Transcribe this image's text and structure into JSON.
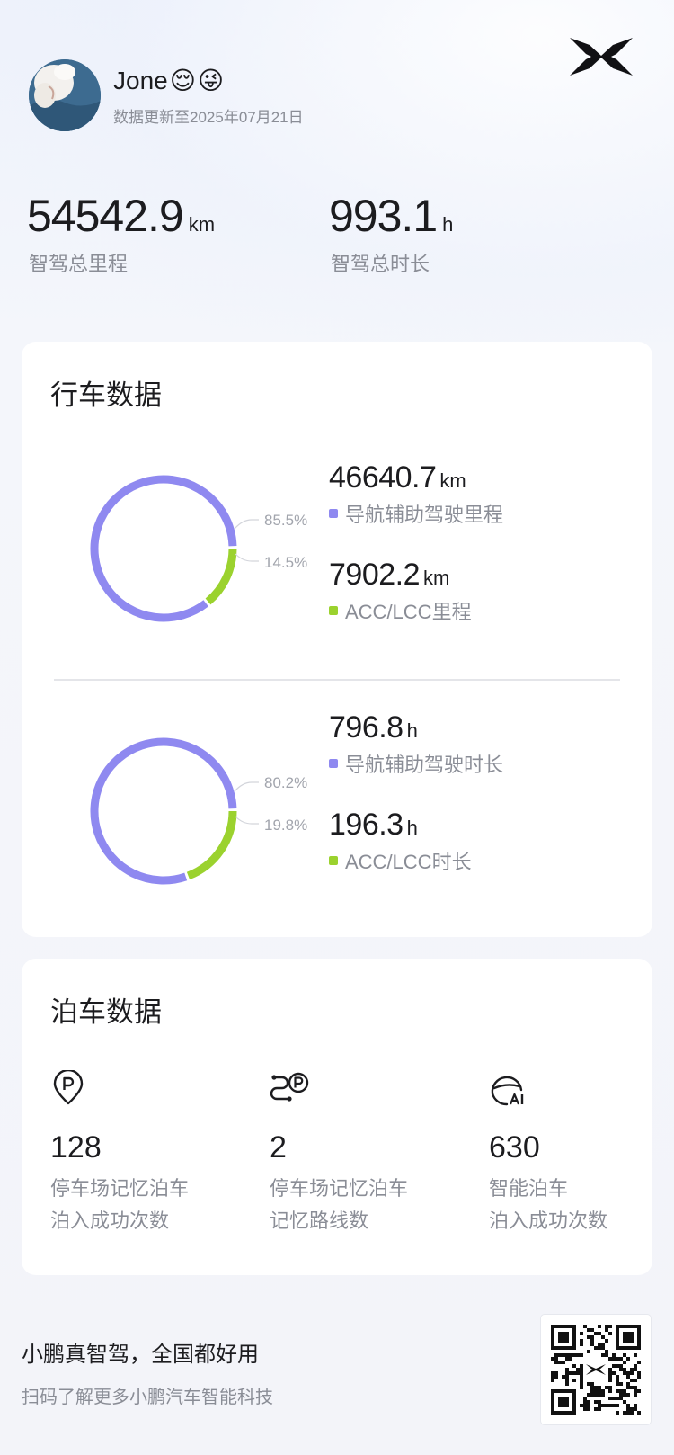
{
  "header": {
    "user_name": "Jone",
    "emojis": [
      "😌",
      "😜"
    ],
    "update_text": "数据更新至2025年07月21日"
  },
  "totals": {
    "mileage": {
      "value": "54542.9",
      "unit": "km",
      "label": "智驾总里程"
    },
    "duration": {
      "value": "993.1",
      "unit": "h",
      "label": "智驾总时长"
    }
  },
  "driving": {
    "title": "行车数据",
    "mileage": {
      "percent_primary": 85.5,
      "percent_secondary": 14.5,
      "percent_primary_label": "85.5%",
      "percent_secondary_label": "14.5%",
      "nav": {
        "value": "46640.7",
        "unit": "km",
        "label": "导航辅助驾驶里程"
      },
      "acc": {
        "value": "7902.2",
        "unit": "km",
        "label": "ACC/LCC里程"
      }
    },
    "duration": {
      "percent_primary": 80.2,
      "percent_secondary": 19.8,
      "percent_primary_label": "80.2%",
      "percent_secondary_label": "19.8%",
      "nav": {
        "value": "796.8",
        "unit": "h",
        "label": "导航辅助驾驶时长"
      },
      "acc": {
        "value": "196.3",
        "unit": "h",
        "label": "ACC/LCC时长"
      }
    }
  },
  "parking": {
    "title": "泊车数据",
    "stats": [
      {
        "icon": "parking-pin-icon",
        "value": "128",
        "label_line1": "停车场记忆泊车",
        "label_line2": "泊入成功次数"
      },
      {
        "icon": "route-parking-icon",
        "value": "2",
        "label_line1": "停车场记忆泊车",
        "label_line2": "记忆路线数"
      },
      {
        "icon": "ai-parking-icon",
        "value": "630",
        "label_line1": "智能泊车",
        "label_line2": "泊入成功次数"
      }
    ]
  },
  "footer": {
    "slogan": "小鹏真智驾，全国都好用",
    "sub_slogan": "扫码了解更多小鹏汽车智能科技"
  },
  "colors": {
    "primary_series": "#8f89f0",
    "secondary_series": "#9bd22e",
    "muted_text": "#8a8d96"
  }
}
